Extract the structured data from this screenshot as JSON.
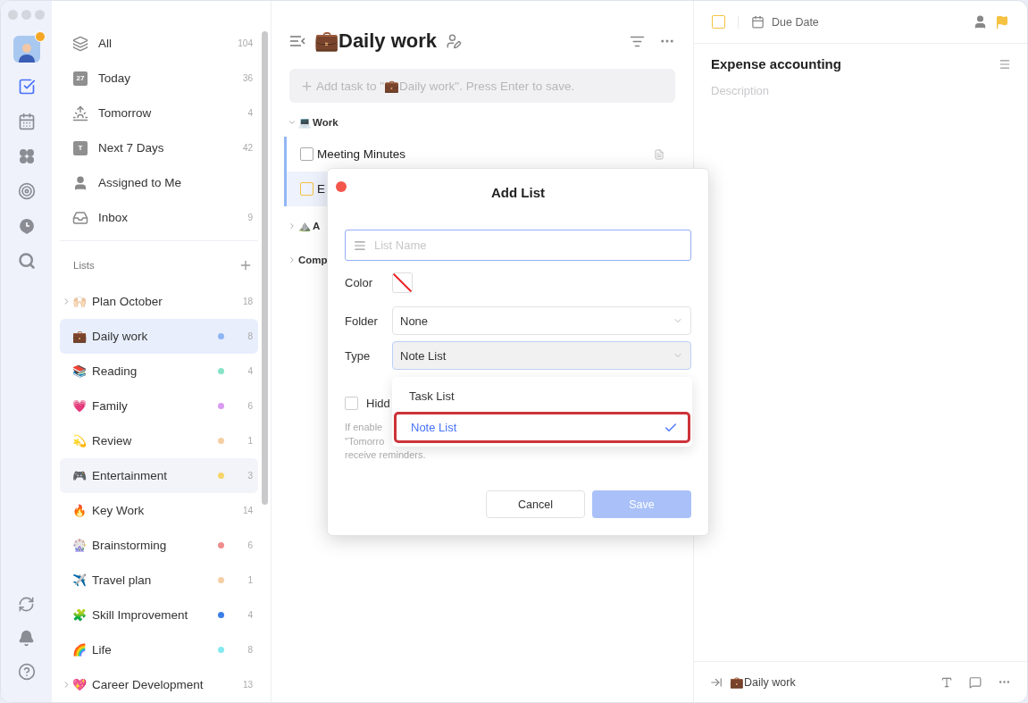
{
  "rail": {
    "items": [
      {
        "kind": "tasks",
        "selected": true
      },
      {
        "kind": "calendar",
        "selected": false
      },
      {
        "kind": "grid",
        "selected": false
      },
      {
        "kind": "target",
        "selected": false
      },
      {
        "kind": "clock",
        "selected": false
      },
      {
        "kind": "search",
        "selected": false
      }
    ],
    "bottom": [
      {
        "kind": "sync"
      },
      {
        "kind": "bell"
      },
      {
        "kind": "help"
      }
    ]
  },
  "sidebar": {
    "smart_lists": [
      {
        "kind": "all",
        "label": "All",
        "count": "104"
      },
      {
        "kind": "today",
        "label": "Today",
        "count": "36",
        "icon_text": "27"
      },
      {
        "kind": "tomorrow",
        "label": "Tomorrow",
        "count": "4"
      },
      {
        "kind": "week",
        "label": "Next 7 Days",
        "count": "42",
        "icon_text": "T"
      },
      {
        "kind": "assigned",
        "label": "Assigned to Me"
      },
      {
        "kind": "inbox",
        "label": "Inbox",
        "count": "9"
      }
    ],
    "lists_heading": "Lists",
    "lists": [
      {
        "emoji": "🙌🏻",
        "name": "Plan October",
        "count": "18",
        "expandable": true,
        "selected": false,
        "hovered": false
      },
      {
        "emoji": "💼",
        "name": "Daily work",
        "count": "8",
        "color": "#8fb5f5",
        "expandable": false,
        "selected": true,
        "hovered": false
      },
      {
        "emoji": "📚",
        "name": "Reading",
        "count": "4",
        "color": "#86e3c6",
        "expandable": false,
        "selected": false,
        "hovered": false
      },
      {
        "emoji": "💗",
        "name": "Family",
        "count": "6",
        "color": "#d99af2",
        "expandable": false,
        "selected": false,
        "hovered": false
      },
      {
        "emoji": "💫",
        "name": "Review",
        "count": "1",
        "color": "#f5cfa4",
        "expandable": false,
        "selected": false,
        "hovered": false
      },
      {
        "emoji": "🎮",
        "name": "Entertainment",
        "count": "3",
        "color": "#f8d56b",
        "expandable": false,
        "selected": false,
        "hovered": true
      },
      {
        "emoji": "🔥",
        "name": "Key Work",
        "count": "14",
        "expandable": false,
        "selected": false,
        "hovered": false
      },
      {
        "emoji": "🎡",
        "name": "Brainstorming",
        "count": "6",
        "color": "#ef8d8d",
        "expandable": false,
        "selected": false,
        "hovered": false
      },
      {
        "emoji": "✈️",
        "name": "Travel plan",
        "count": "1",
        "color": "#f5cfa4",
        "expandable": false,
        "selected": false,
        "hovered": false
      },
      {
        "emoji": "🧩",
        "name": "Skill Improvement",
        "count": "4",
        "color": "#3b7de8",
        "expandable": false,
        "selected": false,
        "hovered": false
      },
      {
        "emoji": "🌈",
        "name": "Life",
        "count": "8",
        "color": "#84eaf0",
        "expandable": false,
        "selected": false,
        "hovered": false
      },
      {
        "emoji": "💖",
        "name": "Career Development",
        "count": "13",
        "expandable": true,
        "selected": false,
        "hovered": false
      }
    ]
  },
  "tasks": {
    "title": "💼Daily work",
    "add_placeholder": "Add task to \"💼Daily work\". Press Enter to save.",
    "sections": [
      {
        "emoji": "💻",
        "name": "Work",
        "expanded": true,
        "tasks": [
          {
            "title": "Meeting Minutes",
            "selected": false,
            "color": "#aaaaaa",
            "has_note": true
          },
          {
            "title": "E",
            "selected": true,
            "color": "#f5c242",
            "has_note": false
          }
        ]
      },
      {
        "emoji": "⛰️",
        "name": "A",
        "expanded": false
      },
      {
        "name": "Comp",
        "expanded": false
      }
    ]
  },
  "dialog": {
    "title": "Add List",
    "name_placeholder": "List Name",
    "color_label": "Color",
    "folder_label": "Folder",
    "folder_value": "None",
    "type_label": "Type",
    "type_value": "Note List",
    "hidden_label": "Hidd",
    "hidden_checked": false,
    "hint_lines": [
      "If enable",
      "\"Tomorro",
      "receive reminders."
    ],
    "cancel": "Cancel",
    "save": "Save",
    "save_disabled": true,
    "type_menu": [
      {
        "label": "Task List",
        "selected": false
      },
      {
        "label": "Note List",
        "selected": true
      }
    ]
  },
  "detail": {
    "checked": false,
    "color": "#f5c242",
    "due_date": "Due Date",
    "flagged": true,
    "title": "Expense accounting",
    "description_placeholder": "Description",
    "list_name": "💼Daily work"
  }
}
